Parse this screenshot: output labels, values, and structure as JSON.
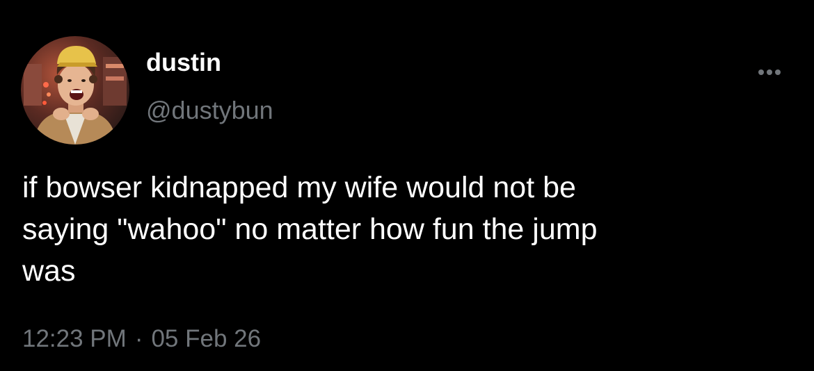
{
  "tweet": {
    "display_name": "dustin",
    "handle": "@dustybun",
    "text": "if bowser kidnapped my wife would not be\nsaying \"wahoo\" no matter how fun the jump\nwas",
    "time": "12:23 PM",
    "separator": "·",
    "date": "05 Feb 26",
    "more_icon": "more-horizontal-icon",
    "avatar_image": "profile-photo"
  },
  "colors": {
    "background": "#000000",
    "text": "#ffffff",
    "secondary": "#71767b"
  }
}
